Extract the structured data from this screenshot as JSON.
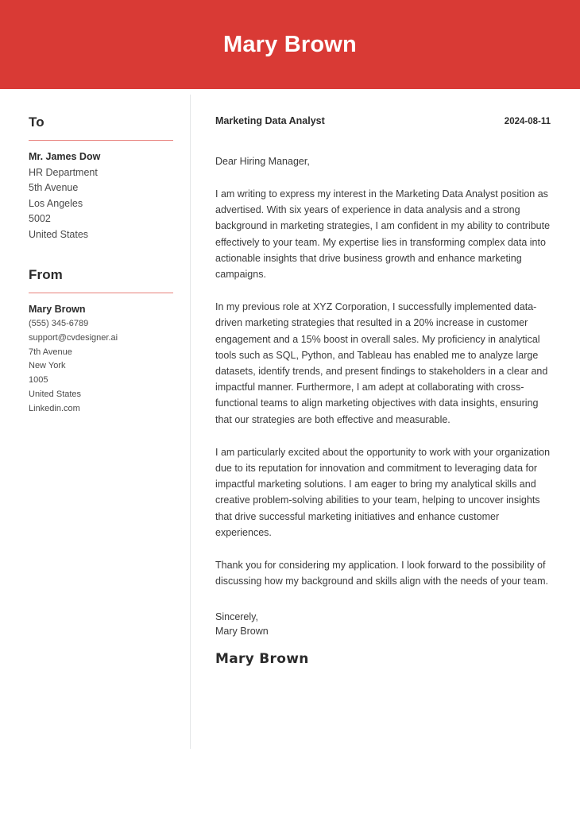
{
  "header": {
    "name": "Mary Brown",
    "background_color": "#d93a35",
    "text_color": "#ffffff"
  },
  "sidebar": {
    "to": {
      "heading": "To",
      "rule_color": "#e8817c",
      "name": "Mr. James Dow",
      "lines": [
        "HR Department",
        "5th Avenue",
        "Los Angeles",
        "5002",
        "United States"
      ]
    },
    "from": {
      "heading": "From",
      "rule_color": "#e8817c",
      "name": "Mary Brown",
      "lines": [
        "(555) 345-6789",
        "support@cvdesigner.ai",
        "7th Avenue",
        "New York",
        "1005",
        "United States",
        "Linkedin.com"
      ]
    }
  },
  "letter": {
    "job_title": "Marketing Data Analyst",
    "date": "2024-08-11",
    "salutation": "Dear Hiring Manager,",
    "paragraphs": [
      "I am writing to express my interest in the Marketing Data Analyst position as advertised. With six years of experience in data analysis and a strong background in marketing strategies, I am confident in my ability to contribute effectively to your team. My expertise lies in transforming complex data into actionable insights that drive business growth and enhance marketing campaigns.",
      "In my previous role at XYZ Corporation, I successfully implemented data-driven marketing strategies that resulted in a 20% increase in customer engagement and a 15% boost in overall sales. My proficiency in analytical tools such as SQL, Python, and Tableau has enabled me to analyze large datasets, identify trends, and present findings to stakeholders in a clear and impactful manner. Furthermore, I am adept at collaborating with cross-functional teams to align marketing objectives with data insights, ensuring that our strategies are both effective and measurable.",
      "I am particularly excited about the opportunity to work with your organization due to its reputation for innovation and commitment to leveraging data for impactful marketing solutions. I am eager to bring my analytical skills and creative problem-solving abilities to your team, helping to uncover insights that drive successful marketing initiatives and enhance customer experiences.",
      "Thank you for considering my application. I look forward to the possibility of discussing how my background and skills align with the needs of your team."
    ],
    "closing_word": "Sincerely,",
    "closing_name": "Mary Brown",
    "signature": "Mary Brown"
  }
}
